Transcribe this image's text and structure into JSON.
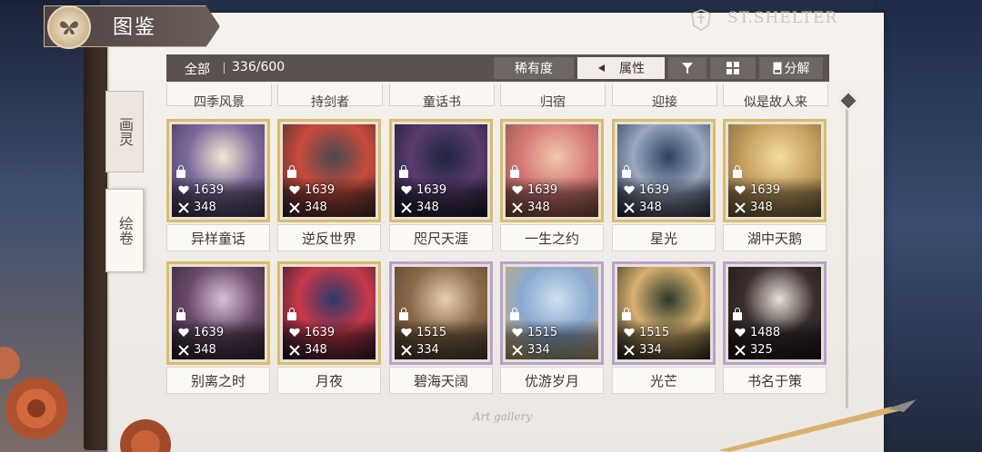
{
  "header": {
    "title": "图鉴",
    "brand": "ST.SHELTER"
  },
  "toolbar": {
    "all_label": "全部",
    "count": "336/600",
    "rarity_label": "稀有度",
    "attribute_label": "属性",
    "decompose_label": "分解"
  },
  "side_tabs": [
    {
      "label": "画灵",
      "active": false
    },
    {
      "label": "绘卷",
      "active": true
    }
  ],
  "previous_row": [
    "四季风景",
    "持剑者",
    "童话书",
    "归宿",
    "迎接",
    "似是故人来"
  ],
  "cards": [
    {
      "name": "异样童话",
      "hearts": "1639",
      "attack": "348",
      "frame": "gold",
      "art": [
        "#f3e9d2",
        "#7d6a9c",
        "#3b2f4d"
      ]
    },
    {
      "name": "逆反世界",
      "hearts": "1639",
      "attack": "348",
      "frame": "gold",
      "art": [
        "#4a4a52",
        "#c84a3a",
        "#2a2a30"
      ]
    },
    {
      "name": "咫尺天涯",
      "hearts": "1639",
      "attack": "348",
      "frame": "gold",
      "art": [
        "#1e2640",
        "#5a3b6e",
        "#0f1424"
      ]
    },
    {
      "name": "一生之约",
      "hearts": "1639",
      "attack": "348",
      "frame": "gold",
      "art": [
        "#f0c8a8",
        "#d67a7a",
        "#7a4a3a"
      ]
    },
    {
      "name": "星光",
      "hearts": "1639",
      "attack": "348",
      "frame": "gold",
      "art": [
        "#2d4060",
        "#9aa8c0",
        "#1a2438"
      ]
    },
    {
      "name": "湖中天鹅",
      "hearts": "1639",
      "attack": "348",
      "frame": "gold",
      "art": [
        "#f3dca0",
        "#c8a060",
        "#6a5a3a"
      ]
    },
    {
      "name": "别离之时",
      "hearts": "1639",
      "attack": "348",
      "frame": "gold",
      "art": [
        "#d8c0d8",
        "#6a4a6a",
        "#2a1e2a"
      ]
    },
    {
      "name": "月夜",
      "hearts": "1639",
      "attack": "348",
      "frame": "gold",
      "art": [
        "#2a3a6a",
        "#c8384a",
        "#101830"
      ]
    },
    {
      "name": "碧海天阔",
      "hearts": "1515",
      "attack": "334",
      "frame": "purple",
      "art": [
        "#e8d0b0",
        "#8a6a4a",
        "#4a3a30"
      ]
    },
    {
      "name": "优游岁月",
      "hearts": "1515",
      "attack": "334",
      "frame": "purple",
      "art": [
        "#cfe0f0",
        "#8aa8d0",
        "#d8b060"
      ]
    },
    {
      "name": "光芒",
      "hearts": "1515",
      "attack": "334",
      "frame": "purple",
      "art": [
        "#2a3a2a",
        "#d8b070",
        "#141a14"
      ]
    },
    {
      "name": "书名于策",
      "hearts": "1488",
      "attack": "325",
      "frame": "purple",
      "art": [
        "#e8e0d8",
        "#3a2e2e",
        "#1a1414"
      ]
    }
  ],
  "footer": {
    "caption": "Art gallery"
  }
}
